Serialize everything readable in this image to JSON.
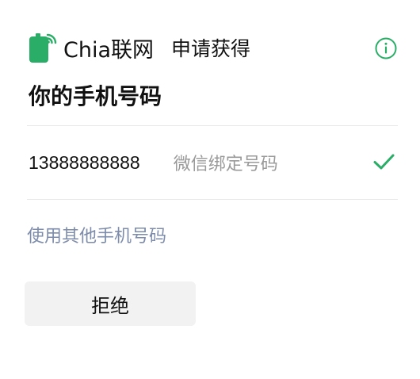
{
  "header": {
    "app_name": "Chia联网",
    "request_text": "申请获得",
    "logo_icon": "phone-signal-icon",
    "info_icon": "info-icon"
  },
  "page": {
    "title": "你的手机号码"
  },
  "phone_option": {
    "number": "13888888888",
    "description": "微信绑定号码",
    "selected": true,
    "check_icon": "check-icon"
  },
  "other_link": {
    "label": "使用其他手机号码"
  },
  "actions": {
    "reject_label": "拒绝"
  },
  "colors": {
    "accent_green": "#2aae67",
    "link_blue_gray": "#7d8cab",
    "button_bg": "#f2f2f2"
  }
}
